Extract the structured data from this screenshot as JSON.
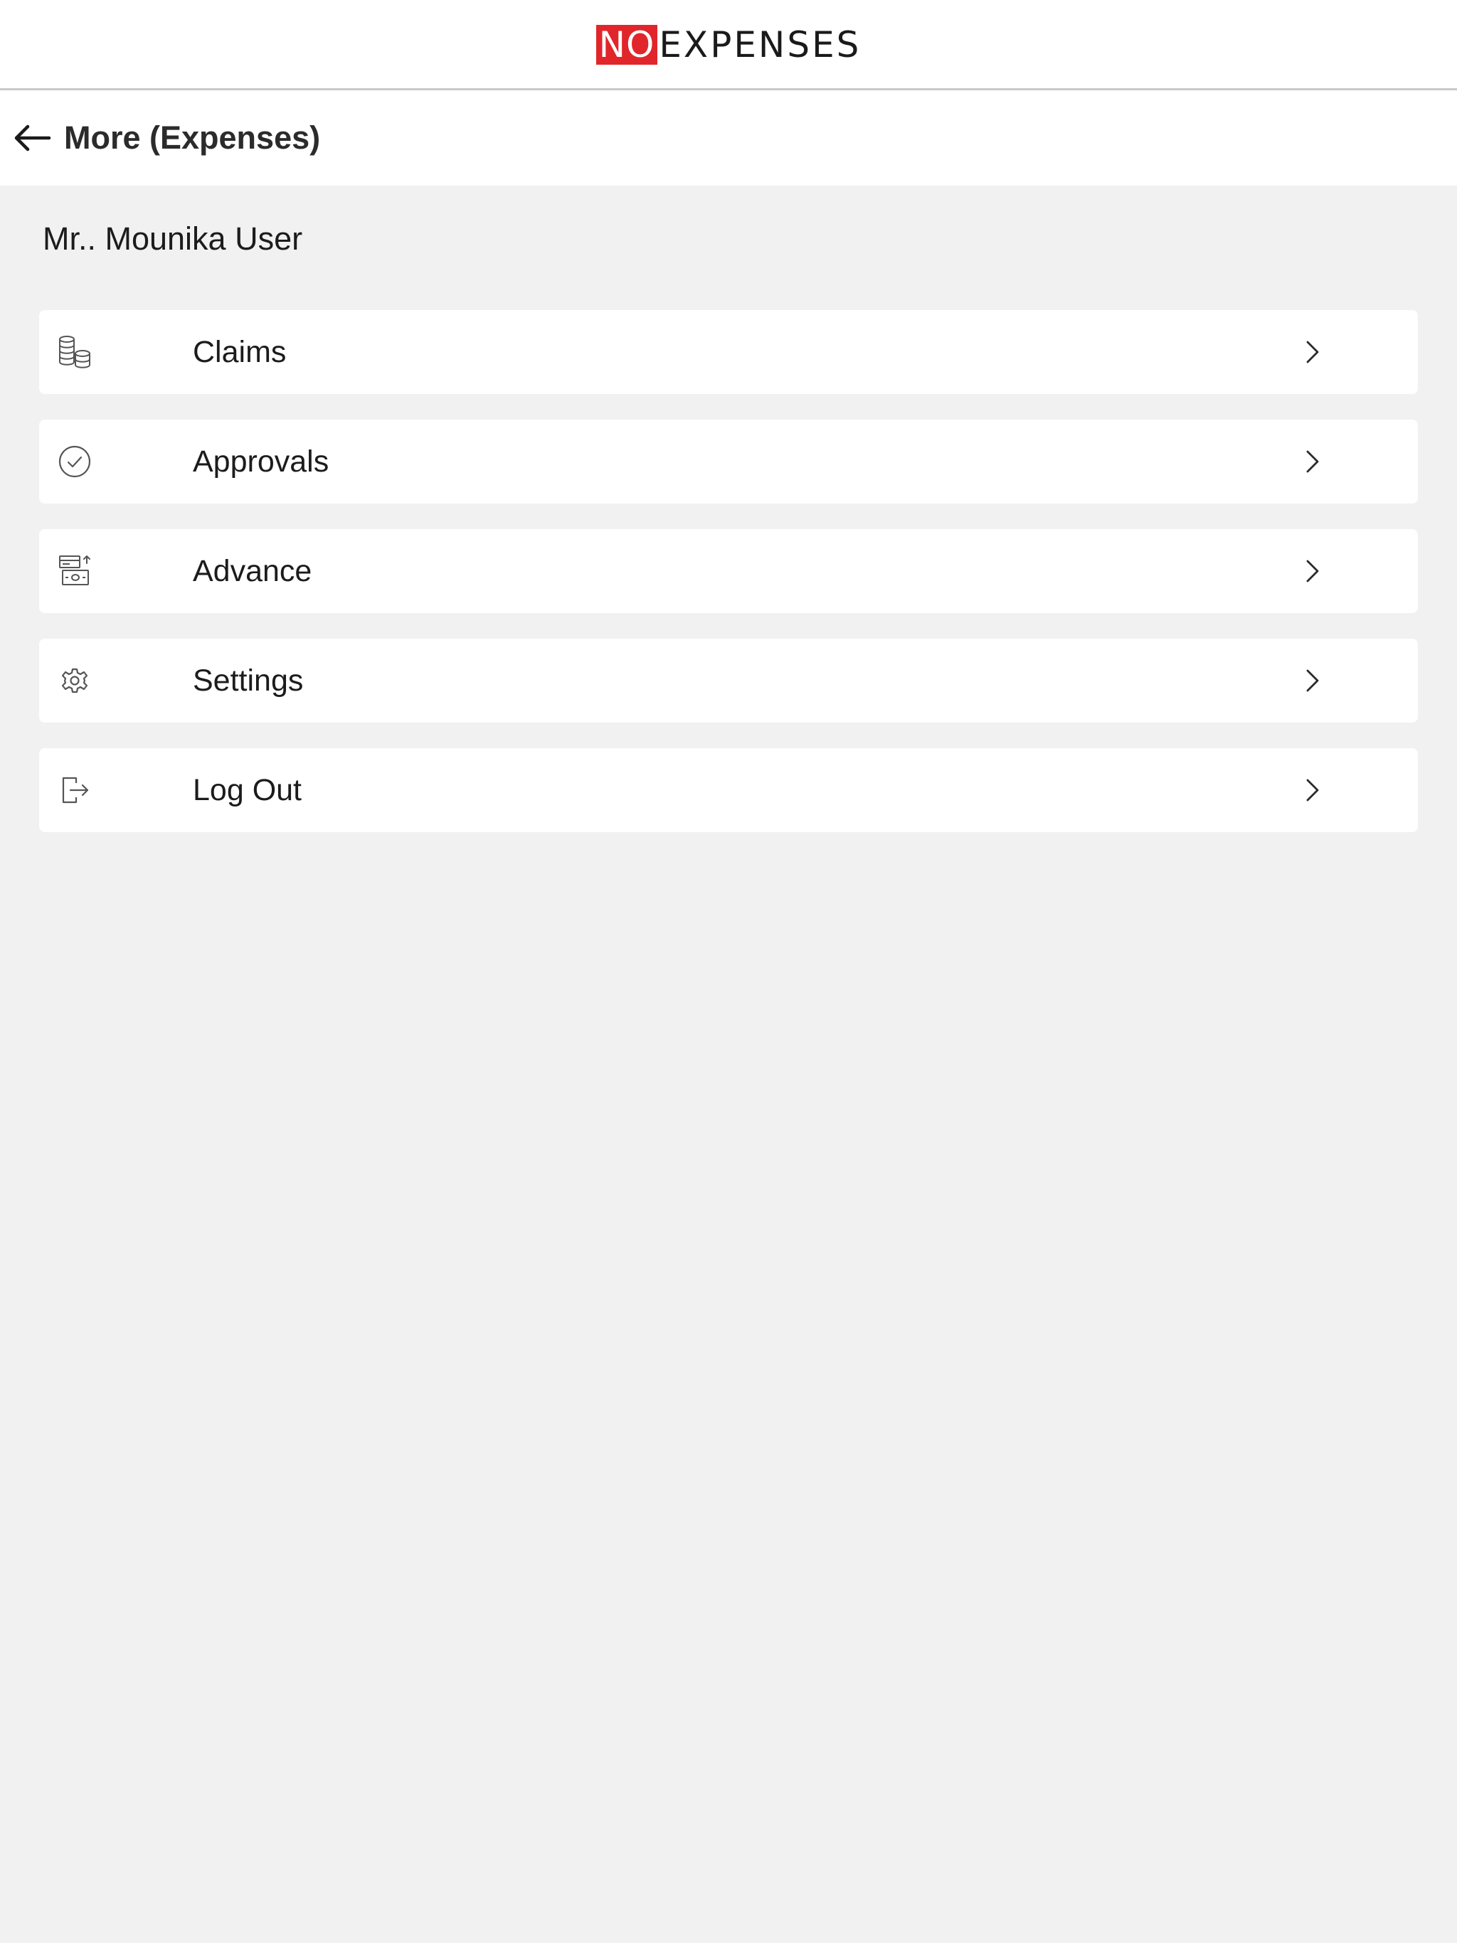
{
  "app": {
    "logo_highlight": "NO",
    "logo_rest": "EXPENSES",
    "brand_color": "#e0262b"
  },
  "header": {
    "back_icon": "arrow-left-icon",
    "title": "More (Expenses)"
  },
  "user": {
    "name": "Mr.. Mounika User"
  },
  "menu": {
    "items": [
      {
        "label": "Claims",
        "icon": "coins-stack-icon"
      },
      {
        "label": "Approvals",
        "icon": "check-circle-icon"
      },
      {
        "label": "Advance",
        "icon": "cash-advance-icon"
      },
      {
        "label": "Settings",
        "icon": "gear-icon"
      },
      {
        "label": "Log Out",
        "icon": "logout-icon"
      }
    ],
    "chevron_icon": "chevron-right-icon"
  }
}
